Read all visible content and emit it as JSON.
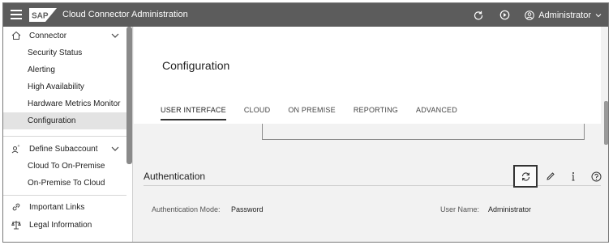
{
  "shell": {
    "logo_text": "SAP",
    "title": "Cloud Connector Administration",
    "user": "Administrator"
  },
  "sidebar": {
    "groups": [
      {
        "label": "Connector",
        "icon": "home-icon",
        "items": [
          "Security Status",
          "Alerting",
          "High Availability",
          "Hardware Metrics Monitor",
          "Configuration"
        ]
      },
      {
        "label": "Define Subaccount",
        "icon": "subaccount-icon",
        "items": [
          "Cloud To On-Premise",
          "On-Premise To Cloud"
        ]
      }
    ],
    "links": [
      {
        "label": "Important Links",
        "icon": "link-icon"
      },
      {
        "label": "Legal Information",
        "icon": "legal-icon"
      }
    ],
    "active_item": "Configuration"
  },
  "main": {
    "page_title": "Configuration",
    "tabs": [
      "USER INTERFACE",
      "CLOUD",
      "ON PREMISE",
      "REPORTING",
      "ADVANCED"
    ],
    "active_tab": "USER INTERFACE",
    "section": {
      "title": "Authentication",
      "actions": [
        "refresh-icon",
        "edit-icon",
        "info-icon",
        "help-icon"
      ],
      "auth_mode_label": "Authentication Mode:",
      "auth_mode_value": "Password",
      "user_name_label": "User Name:",
      "user_name_value": "Administrator"
    }
  },
  "colors": {
    "shell_bg": "#5c5c5c",
    "content_bg": "#f2f2f2",
    "active_nav_bg": "#e3e3e3"
  }
}
